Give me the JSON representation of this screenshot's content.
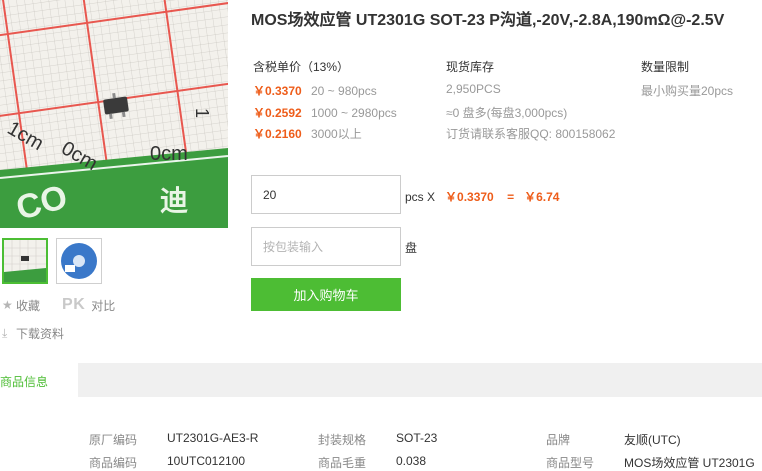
{
  "product": {
    "title": "MOS场效应管 UT2301G SOT-23 P沟道,-20V,-2.8A,190mΩ@-2.5V"
  },
  "actions": {
    "favorite": "收藏",
    "compare_pk": "PK",
    "compare": "对比",
    "download": "下载资料"
  },
  "price_table": {
    "header_price": "含税单价（13%）",
    "header_stock": "现货库存",
    "header_limit": "数量限制",
    "tiers": [
      {
        "price": "￥0.3370",
        "range": "20 ~ 980pcs"
      },
      {
        "price": "￥0.2592",
        "range": "1000 ~ 2980pcs"
      },
      {
        "price": "￥0.2160",
        "range": "3000以上"
      }
    ],
    "stock_pcs": "2,950PCS",
    "stock_reels": "≈0 盘多(每盘3,000pcs)",
    "order_contact": "订货请联系客服QQ: 800158062",
    "min_buy": "最小购买量20pcs"
  },
  "order": {
    "quantity_value": "20",
    "unit": "pcs X",
    "unit_price": "￥0.3370",
    "equals": "=",
    "total": "￥6.74",
    "pack_placeholder": "按包装输入",
    "pack_unit": "盘",
    "add_to_cart": "加入购物车"
  },
  "image_marks": {
    "cm1": "1cm",
    "cm0a": "0cm",
    "cm0b": "0cm",
    "brand_text": "迪"
  },
  "info": {
    "tab_label": "商品信息",
    "rows": [
      [
        {
          "label": "原厂编码",
          "value": "UT2301G-AE3-R"
        },
        {
          "label": "封装规格",
          "value": "SOT-23"
        },
        {
          "label": "品牌",
          "value": "友顺(UTC)"
        }
      ],
      [
        {
          "label": "商品编码",
          "value": "10UTC012100"
        },
        {
          "label": "商品毛重",
          "value": "0.038"
        },
        {
          "label": "商品型号",
          "value": "MOS场效应管 UT2301G ."
        }
      ]
    ]
  },
  "colors": {
    "accent_green": "#4dbd34",
    "price_orange": "#ee5d1a",
    "grid_red": "#e8574f"
  }
}
